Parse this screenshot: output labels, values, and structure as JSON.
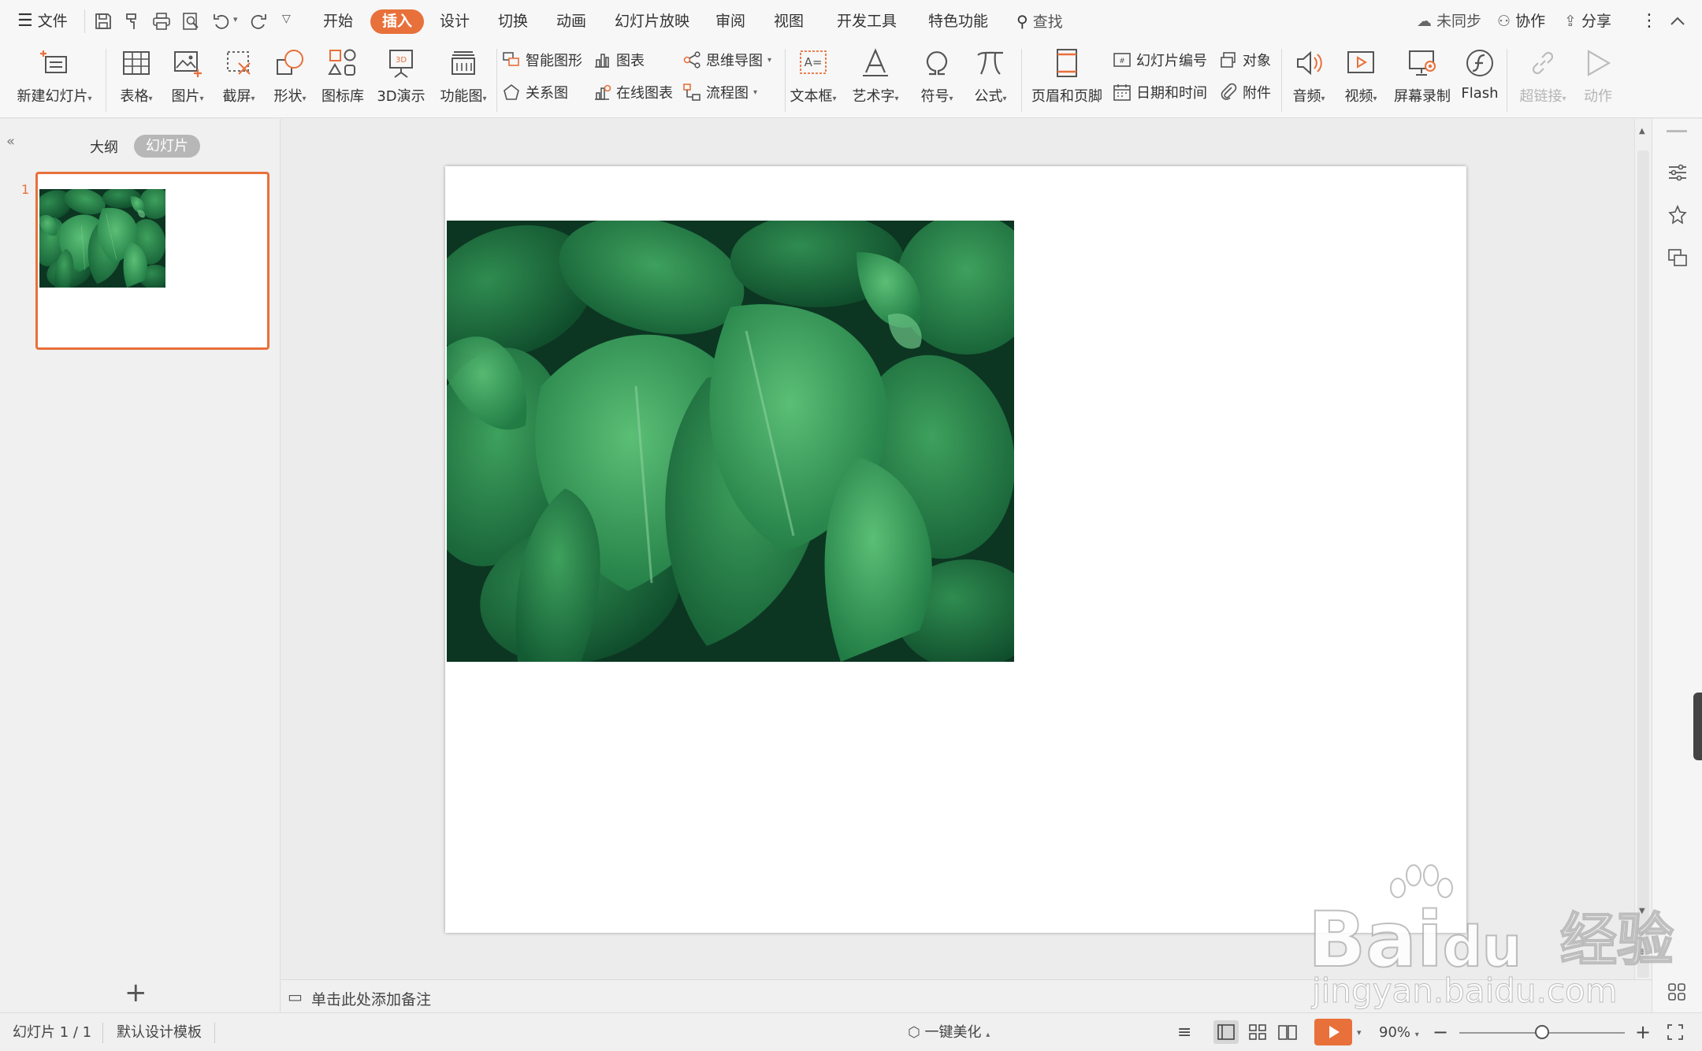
{
  "menubar": {
    "file_label": "文件",
    "tabs": [
      "开始",
      "插入",
      "设计",
      "切换",
      "动画",
      "幻灯片放映",
      "审阅",
      "视图",
      "开发工具",
      "特色功能"
    ],
    "active_tab": "插入",
    "search_label": "查找",
    "sync_label": "未同步",
    "collab_label": "协作",
    "share_label": "分享"
  },
  "ribbon": {
    "new_slide": "新建幻灯片",
    "table": "表格",
    "picture": "图片",
    "screenshot": "截屏",
    "shape": "形状",
    "icon_library": "图标库",
    "demo_3d": "3D演示",
    "function_chart": "功能图",
    "smart_art": "智能图形",
    "chart": "图表",
    "relation": "关系图",
    "online_chart": "在线图表",
    "mindmap": "思维导图",
    "flowchart": "流程图",
    "textbox": "文本框",
    "wordart": "艺术字",
    "symbol": "符号",
    "formula": "公式",
    "header_footer": "页眉和页脚",
    "slide_number": "幻灯片编号",
    "date_time": "日期和时间",
    "object": "对象",
    "attachment": "附件",
    "audio": "音频",
    "video": "视频",
    "screen_record": "屏幕录制",
    "flash": "Flash",
    "hyperlink": "超链接",
    "action": "动作"
  },
  "leftpanel": {
    "tab_outline": "大纲",
    "tab_slides": "幻灯片",
    "active_tab": "幻灯片",
    "slide_number": "1",
    "add_label": "+"
  },
  "notes": {
    "placeholder": "单击此处添加备注"
  },
  "statusbar": {
    "slide_info": "幻灯片 1 / 1",
    "template": "默认设计模板",
    "beautify": "一键美化",
    "zoom": "90%",
    "zoom_level": 0.5
  },
  "watermark": {
    "brand": "Bai",
    "brand_du": "du",
    "brand_cn": "经验",
    "url": "jingyan.baidu.com"
  },
  "colors": {
    "accent": "#e8703a",
    "leaf_dark": "#0e3d27",
    "leaf_mid": "#2a8a4e",
    "leaf_light": "#4fb36a"
  }
}
